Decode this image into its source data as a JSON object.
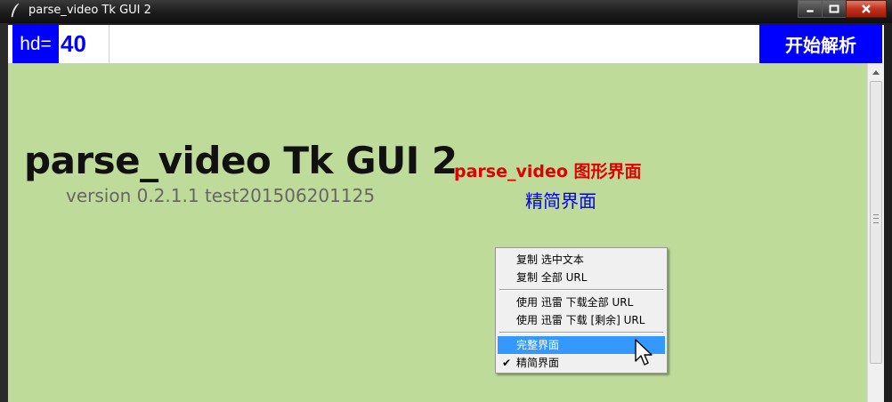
{
  "window": {
    "title": "parse_video Tk GUI 2"
  },
  "toolbar": {
    "hd_label": "hd=",
    "hd_value": "40",
    "url_value": "",
    "start_button": "开始解析"
  },
  "main": {
    "title": "parse_video Tk GUI 2",
    "version": "version 0.2.1.1 test201506201125",
    "subtitle": "parse_video 图形界面",
    "mode_label": "精简界面"
  },
  "context_menu": {
    "items": [
      {
        "label": "复制 选中文本"
      },
      {
        "label": "复制 全部 URL"
      },
      {
        "label": "使用 迅雷 下载全部 URL"
      },
      {
        "label": "使用 迅雷 下载 [剩余] URL"
      },
      {
        "label": "完整界面",
        "selected": true
      },
      {
        "label": "精简界面",
        "checked": true,
        "check_glyph": "✔"
      }
    ]
  },
  "colors": {
    "background": "#bedb9a",
    "accent_blue": "#0000ff",
    "subtitle_red": "#e00000",
    "menu_highlight": "#3399ff"
  }
}
